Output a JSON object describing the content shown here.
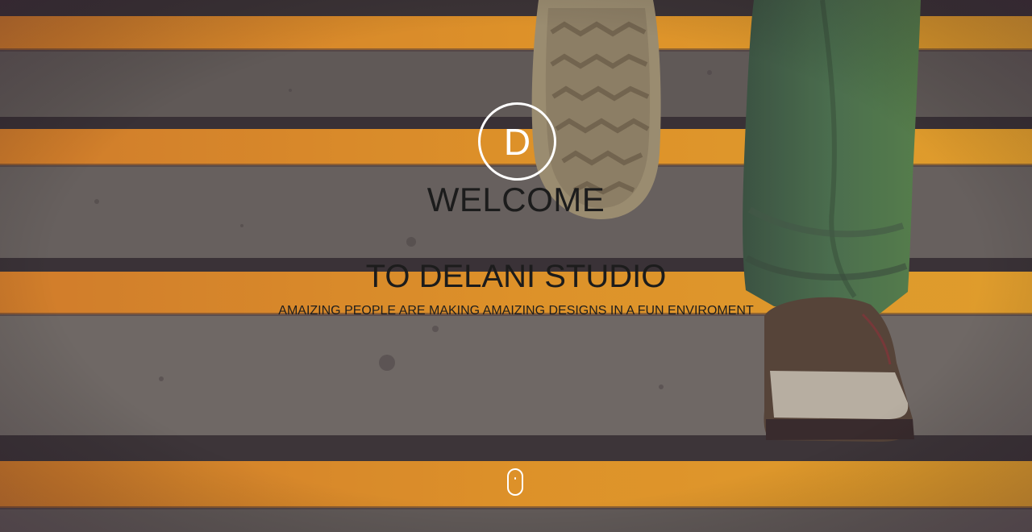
{
  "hero": {
    "logo_letter": "D",
    "welcome": "WELCOME",
    "studio": "TO DELANI STUDIO",
    "tagline": "AMAIZING PEOPLE ARE MAKING AMAIZING DESIGNS IN A FUN ENVIROMENT"
  },
  "colors": {
    "stripe_orange": "#f2a12a",
    "step_gray": "#6a665f",
    "text_dark": "#1c1c1c",
    "white": "#ffffff"
  },
  "icons": {
    "scroll": "mouse-scroll-icon"
  }
}
